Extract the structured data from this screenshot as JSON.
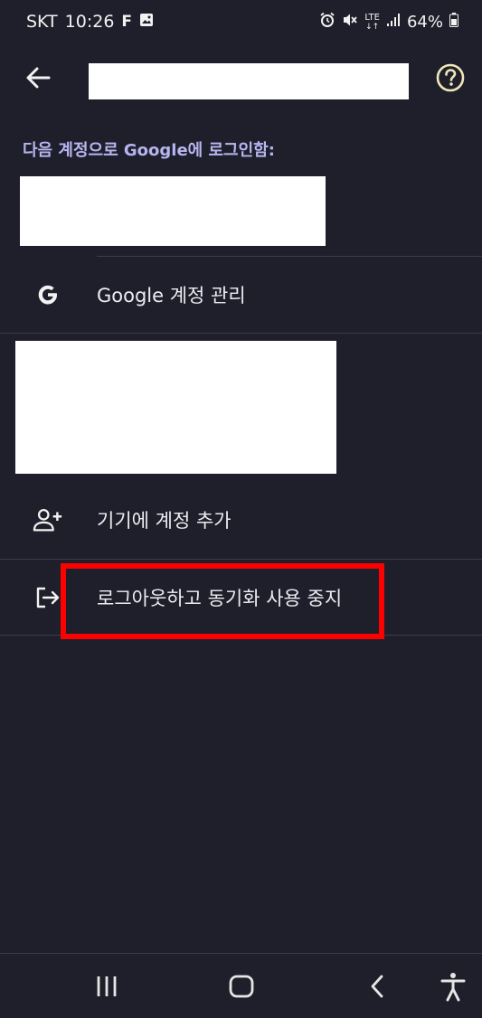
{
  "status_bar": {
    "carrier": "SKT",
    "time": "10:26",
    "notif_f": "F",
    "network": "LTE",
    "battery": "64%"
  },
  "header": {
    "back_icon": "arrow-left-icon",
    "help_icon": "help-circle-icon"
  },
  "signed_in_label": "다음 계정으로 Google에 로그인함:",
  "menu": {
    "manage_account": "Google 계정 관리",
    "add_account": "기기에 계정 추가",
    "sign_out": "로그아웃하고 동기화 사용 중지"
  },
  "nav": {
    "recents_icon": "recents-icon",
    "home_icon": "home-icon",
    "back_icon": "back-chevron-icon",
    "accessibility_icon": "accessibility-icon"
  },
  "colors": {
    "background": "#1f1f2b",
    "accent_label": "#b7b5f0",
    "highlight": "#ff0000"
  }
}
